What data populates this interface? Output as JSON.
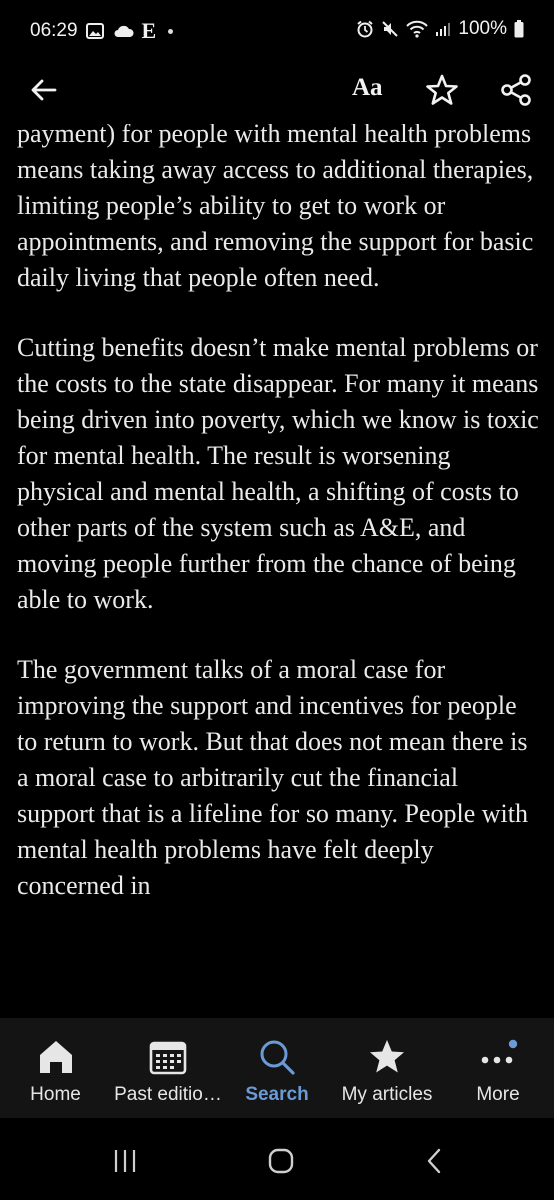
{
  "status_bar": {
    "time": "06:29",
    "app_letter": "E",
    "battery": "100%"
  },
  "toolbar": {
    "text_size_label": "Aa"
  },
  "article": {
    "paragraphs": [
      "payment) for people with mental health problems means taking away access to additional therapies, limiting people’s ability to get to work or appointments, and removing the support for basic daily living that people often need.",
      "Cutting benefits doesn’t make mental problems or the costs to the state disappear. For many it means being driven into poverty, which we know is toxic for mental health. The result is worsening physical and mental health, a shifting of costs to other parts of the system such as A&E, and moving people further from the chance of being able to work.",
      "The government talks of a moral case for improving the support and incentives for people to return to work. But that does not mean there is a moral case to arbitrarily cut the financial support that is a lifeline for so many. People with mental health problems have felt deeply concerned in"
    ]
  },
  "bottom_nav": {
    "items": [
      {
        "label": "Home",
        "icon": "home-icon"
      },
      {
        "label": "Past editio…",
        "icon": "calendar-icon"
      },
      {
        "label": "Search",
        "icon": "search-icon",
        "active": true
      },
      {
        "label": "My articles",
        "icon": "star-filled-icon"
      },
      {
        "label": "More",
        "icon": "more-dots-icon"
      }
    ]
  },
  "colors": {
    "background": "#000000",
    "text": "#eaeaea",
    "nav_background": "#141414",
    "active": "#6b9bd6"
  }
}
